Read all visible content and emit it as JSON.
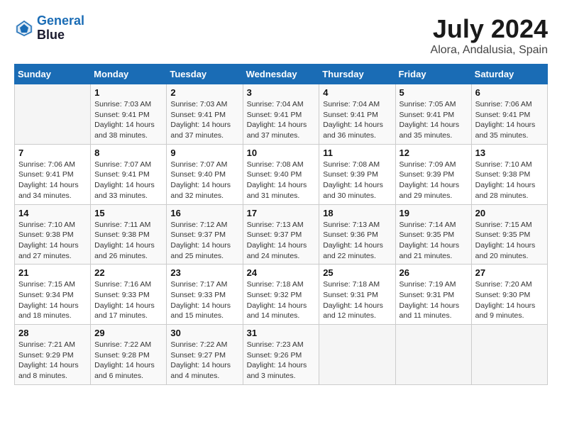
{
  "logo": {
    "line1": "General",
    "line2": "Blue"
  },
  "title": "July 2024",
  "subtitle": "Alora, Andalusia, Spain",
  "days_of_week": [
    "Sunday",
    "Monday",
    "Tuesday",
    "Wednesday",
    "Thursday",
    "Friday",
    "Saturday"
  ],
  "weeks": [
    [
      {
        "num": "",
        "sunrise": "",
        "sunset": "",
        "daylight": ""
      },
      {
        "num": "1",
        "sunrise": "Sunrise: 7:03 AM",
        "sunset": "Sunset: 9:41 PM",
        "daylight": "Daylight: 14 hours and 38 minutes."
      },
      {
        "num": "2",
        "sunrise": "Sunrise: 7:03 AM",
        "sunset": "Sunset: 9:41 PM",
        "daylight": "Daylight: 14 hours and 37 minutes."
      },
      {
        "num": "3",
        "sunrise": "Sunrise: 7:04 AM",
        "sunset": "Sunset: 9:41 PM",
        "daylight": "Daylight: 14 hours and 37 minutes."
      },
      {
        "num": "4",
        "sunrise": "Sunrise: 7:04 AM",
        "sunset": "Sunset: 9:41 PM",
        "daylight": "Daylight: 14 hours and 36 minutes."
      },
      {
        "num": "5",
        "sunrise": "Sunrise: 7:05 AM",
        "sunset": "Sunset: 9:41 PM",
        "daylight": "Daylight: 14 hours and 35 minutes."
      },
      {
        "num": "6",
        "sunrise": "Sunrise: 7:06 AM",
        "sunset": "Sunset: 9:41 PM",
        "daylight": "Daylight: 14 hours and 35 minutes."
      }
    ],
    [
      {
        "num": "7",
        "sunrise": "Sunrise: 7:06 AM",
        "sunset": "Sunset: 9:41 PM",
        "daylight": "Daylight: 14 hours and 34 minutes."
      },
      {
        "num": "8",
        "sunrise": "Sunrise: 7:07 AM",
        "sunset": "Sunset: 9:41 PM",
        "daylight": "Daylight: 14 hours and 33 minutes."
      },
      {
        "num": "9",
        "sunrise": "Sunrise: 7:07 AM",
        "sunset": "Sunset: 9:40 PM",
        "daylight": "Daylight: 14 hours and 32 minutes."
      },
      {
        "num": "10",
        "sunrise": "Sunrise: 7:08 AM",
        "sunset": "Sunset: 9:40 PM",
        "daylight": "Daylight: 14 hours and 31 minutes."
      },
      {
        "num": "11",
        "sunrise": "Sunrise: 7:08 AM",
        "sunset": "Sunset: 9:39 PM",
        "daylight": "Daylight: 14 hours and 30 minutes."
      },
      {
        "num": "12",
        "sunrise": "Sunrise: 7:09 AM",
        "sunset": "Sunset: 9:39 PM",
        "daylight": "Daylight: 14 hours and 29 minutes."
      },
      {
        "num": "13",
        "sunrise": "Sunrise: 7:10 AM",
        "sunset": "Sunset: 9:38 PM",
        "daylight": "Daylight: 14 hours and 28 minutes."
      }
    ],
    [
      {
        "num": "14",
        "sunrise": "Sunrise: 7:10 AM",
        "sunset": "Sunset: 9:38 PM",
        "daylight": "Daylight: 14 hours and 27 minutes."
      },
      {
        "num": "15",
        "sunrise": "Sunrise: 7:11 AM",
        "sunset": "Sunset: 9:38 PM",
        "daylight": "Daylight: 14 hours and 26 minutes."
      },
      {
        "num": "16",
        "sunrise": "Sunrise: 7:12 AM",
        "sunset": "Sunset: 9:37 PM",
        "daylight": "Daylight: 14 hours and 25 minutes."
      },
      {
        "num": "17",
        "sunrise": "Sunrise: 7:13 AM",
        "sunset": "Sunset: 9:37 PM",
        "daylight": "Daylight: 14 hours and 24 minutes."
      },
      {
        "num": "18",
        "sunrise": "Sunrise: 7:13 AM",
        "sunset": "Sunset: 9:36 PM",
        "daylight": "Daylight: 14 hours and 22 minutes."
      },
      {
        "num": "19",
        "sunrise": "Sunrise: 7:14 AM",
        "sunset": "Sunset: 9:35 PM",
        "daylight": "Daylight: 14 hours and 21 minutes."
      },
      {
        "num": "20",
        "sunrise": "Sunrise: 7:15 AM",
        "sunset": "Sunset: 9:35 PM",
        "daylight": "Daylight: 14 hours and 20 minutes."
      }
    ],
    [
      {
        "num": "21",
        "sunrise": "Sunrise: 7:15 AM",
        "sunset": "Sunset: 9:34 PM",
        "daylight": "Daylight: 14 hours and 18 minutes."
      },
      {
        "num": "22",
        "sunrise": "Sunrise: 7:16 AM",
        "sunset": "Sunset: 9:33 PM",
        "daylight": "Daylight: 14 hours and 17 minutes."
      },
      {
        "num": "23",
        "sunrise": "Sunrise: 7:17 AM",
        "sunset": "Sunset: 9:33 PM",
        "daylight": "Daylight: 14 hours and 15 minutes."
      },
      {
        "num": "24",
        "sunrise": "Sunrise: 7:18 AM",
        "sunset": "Sunset: 9:32 PM",
        "daylight": "Daylight: 14 hours and 14 minutes."
      },
      {
        "num": "25",
        "sunrise": "Sunrise: 7:18 AM",
        "sunset": "Sunset: 9:31 PM",
        "daylight": "Daylight: 14 hours and 12 minutes."
      },
      {
        "num": "26",
        "sunrise": "Sunrise: 7:19 AM",
        "sunset": "Sunset: 9:31 PM",
        "daylight": "Daylight: 14 hours and 11 minutes."
      },
      {
        "num": "27",
        "sunrise": "Sunrise: 7:20 AM",
        "sunset": "Sunset: 9:30 PM",
        "daylight": "Daylight: 14 hours and 9 minutes."
      }
    ],
    [
      {
        "num": "28",
        "sunrise": "Sunrise: 7:21 AM",
        "sunset": "Sunset: 9:29 PM",
        "daylight": "Daylight: 14 hours and 8 minutes."
      },
      {
        "num": "29",
        "sunrise": "Sunrise: 7:22 AM",
        "sunset": "Sunset: 9:28 PM",
        "daylight": "Daylight: 14 hours and 6 minutes."
      },
      {
        "num": "30",
        "sunrise": "Sunrise: 7:22 AM",
        "sunset": "Sunset: 9:27 PM",
        "daylight": "Daylight: 14 hours and 4 minutes."
      },
      {
        "num": "31",
        "sunrise": "Sunrise: 7:23 AM",
        "sunset": "Sunset: 9:26 PM",
        "daylight": "Daylight: 14 hours and 3 minutes."
      },
      {
        "num": "",
        "sunrise": "",
        "sunset": "",
        "daylight": ""
      },
      {
        "num": "",
        "sunrise": "",
        "sunset": "",
        "daylight": ""
      },
      {
        "num": "",
        "sunrise": "",
        "sunset": "",
        "daylight": ""
      }
    ]
  ]
}
